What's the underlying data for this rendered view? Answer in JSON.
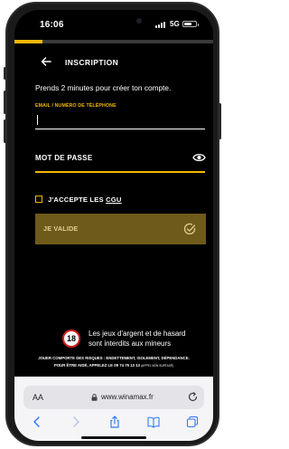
{
  "status_bar": {
    "time": "16:06",
    "network": "5G",
    "battery_level": 0.7
  },
  "progress": {
    "value": 0.14,
    "color": "#f2b705"
  },
  "header": {
    "back_icon": "arrow-left-icon",
    "title": "INSCRIPTION"
  },
  "form": {
    "subtitle": "Prends 2 minutes pour créer ton compte.",
    "email_label": "EMAIL / NUMÉRO DE TÉLÉPHONE",
    "email_value": "",
    "password_label": "MOT DE PASSE",
    "password_value": "",
    "show_password_icon": "eye-icon",
    "accept_prefix": "J'ACCEPTE LES ",
    "accept_link": "CGU",
    "accept_checked": false,
    "submit_label": "JE VALIDE",
    "submit_icon": "check-circle-icon"
  },
  "warning": {
    "badge": "18",
    "line1": "Les jeux d'argent et de hasard",
    "line2": "sont interdits aux mineurs",
    "legal1": "JOUER COMPORTE DES RISQUES : ENDETTEMENT, ISOLEMENT, DÉPENDANCE.",
    "legal2_main": "POUR ÊTRE AIDÉ, APPELEZ LE 09 74 75 13 13",
    "legal2_small": "(APPEL NON SURTAXÉ)"
  },
  "browser": {
    "text_size_label": "AA",
    "url": "www.winamax.fr",
    "toolbar": [
      "back-icon",
      "forward-icon",
      "share-icon",
      "bookmarks-icon",
      "tabs-icon"
    ]
  },
  "colors": {
    "accent": "#f2b705",
    "button": "#6e5a1a",
    "background": "#000000"
  }
}
